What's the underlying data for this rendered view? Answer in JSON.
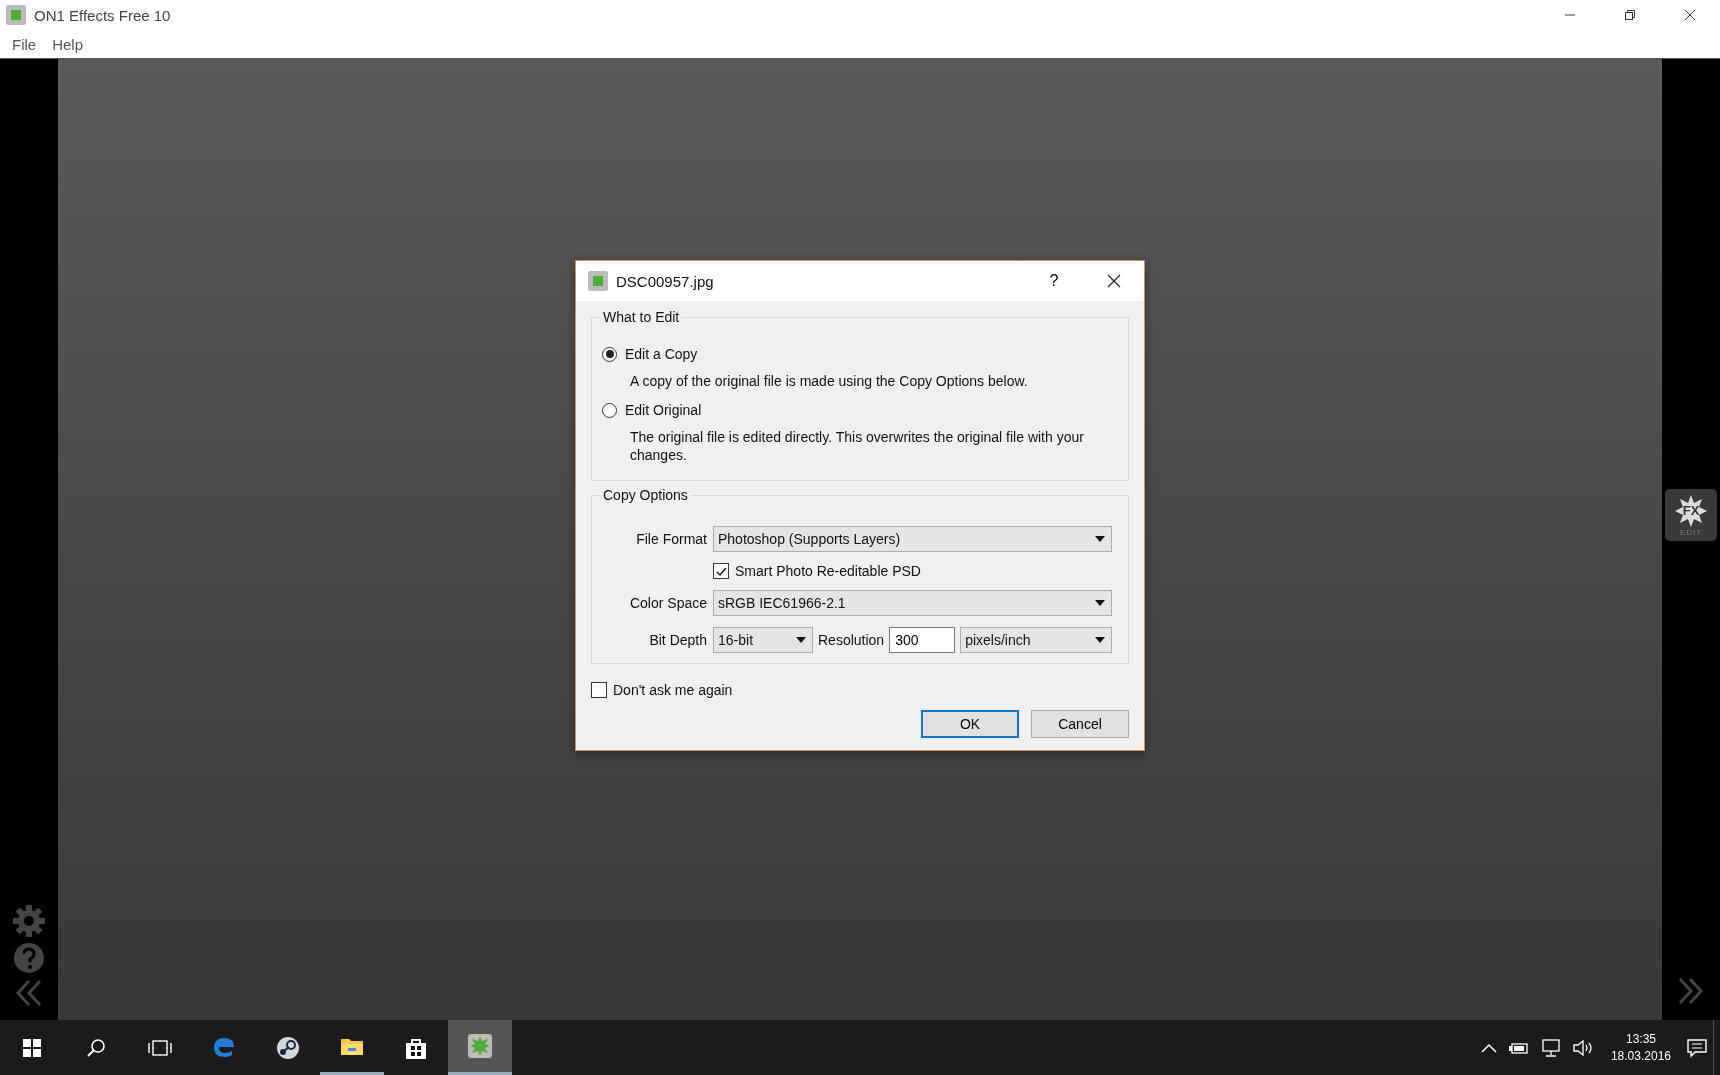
{
  "window": {
    "title": "ON1 Effects Free 10"
  },
  "menu": [
    "File",
    "Help"
  ],
  "left_tools": [
    {
      "kind": "gear"
    },
    {
      "kind": "help"
    },
    {
      "kind": "collapse"
    }
  ],
  "right_panel": {
    "fx_button": {
      "label": "FX",
      "caption": "EDIT"
    }
  },
  "dialog": {
    "title": "DSC00957.jpg",
    "help": "?",
    "what_to_edit": {
      "title": "What to Edit",
      "options": [
        {
          "label": "Edit a Copy",
          "selected": true,
          "description": "A copy of the original file is made using the Copy Options below."
        },
        {
          "label": "Edit Original",
          "selected": false,
          "description": "The original file is edited directly.  This overwrites the original file with your changes."
        }
      ]
    },
    "copy_options": {
      "title": "Copy Options",
      "file_format": {
        "label": "File Format",
        "value": "Photoshop (Supports Layers)"
      },
      "smart_photo": {
        "label": "Smart Photo Re-editable PSD",
        "checked": true
      },
      "color_space": {
        "label": "Color Space",
        "value": "sRGB IEC61966-2.1"
      },
      "bit_depth": {
        "label": "Bit Depth",
        "value": "16-bit"
      },
      "resolution": {
        "label": "Resolution",
        "value": "300",
        "unit": "pixels/inch"
      }
    },
    "dont_ask": {
      "label": "Don't ask me again",
      "checked": false
    },
    "buttons": [
      {
        "label": "OK",
        "default": true
      },
      {
        "label": "Cancel",
        "default": false
      }
    ]
  },
  "taskbar": {
    "apps": [
      {
        "kind": "edge",
        "open": false,
        "active": false
      },
      {
        "kind": "steam",
        "open": false,
        "active": false
      },
      {
        "kind": "explorer",
        "open": true,
        "active": false
      },
      {
        "kind": "store",
        "open": false,
        "active": false
      },
      {
        "kind": "on1",
        "open": true,
        "active": true
      }
    ],
    "time": "13:35",
    "date": "18.03.2016"
  }
}
